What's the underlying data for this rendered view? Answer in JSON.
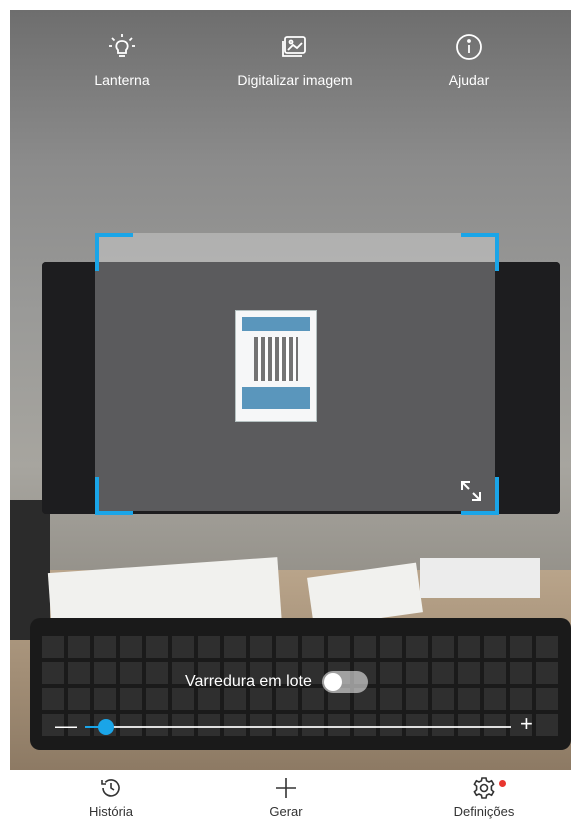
{
  "top_bar": {
    "flashlight": {
      "label": "Lanterna",
      "icon": "flashlight-icon"
    },
    "scan_image": {
      "label": "Digitalizar imagem",
      "icon": "image-icon"
    },
    "help": {
      "label": "Ajudar",
      "icon": "info-icon"
    }
  },
  "scanner": {
    "frame_color": "#1aa5e8",
    "batch_scan": {
      "label": "Varredura em lote",
      "enabled": false
    },
    "zoom": {
      "minus_label": "—",
      "plus_label": "+",
      "level": 0.05
    }
  },
  "bottom_nav": {
    "history": {
      "label": "História",
      "icon": "history-icon"
    },
    "generate": {
      "label": "Gerar",
      "icon": "plus-icon"
    },
    "settings": {
      "label": "Definições",
      "icon": "gear-icon",
      "badge_color": "#e8362f"
    }
  }
}
